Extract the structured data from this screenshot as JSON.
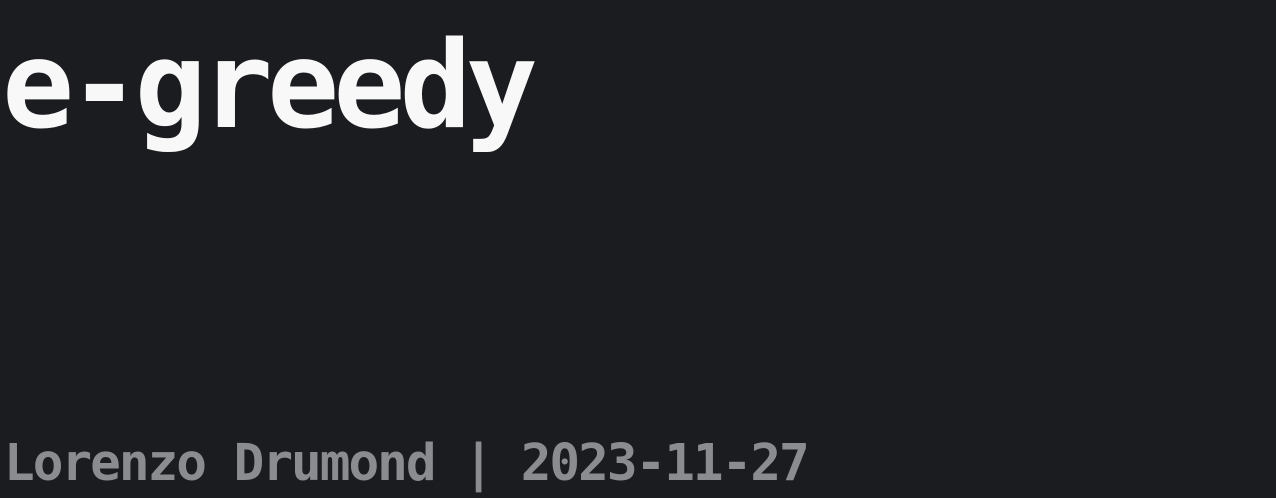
{
  "post": {
    "title": "e-greedy",
    "author": "Lorenzo Drumond",
    "separator": " | ",
    "date": "2023-11-27"
  },
  "colors": {
    "background": "#1b1c20",
    "title": "#f8f8f8",
    "meta": "#8b8c90"
  }
}
